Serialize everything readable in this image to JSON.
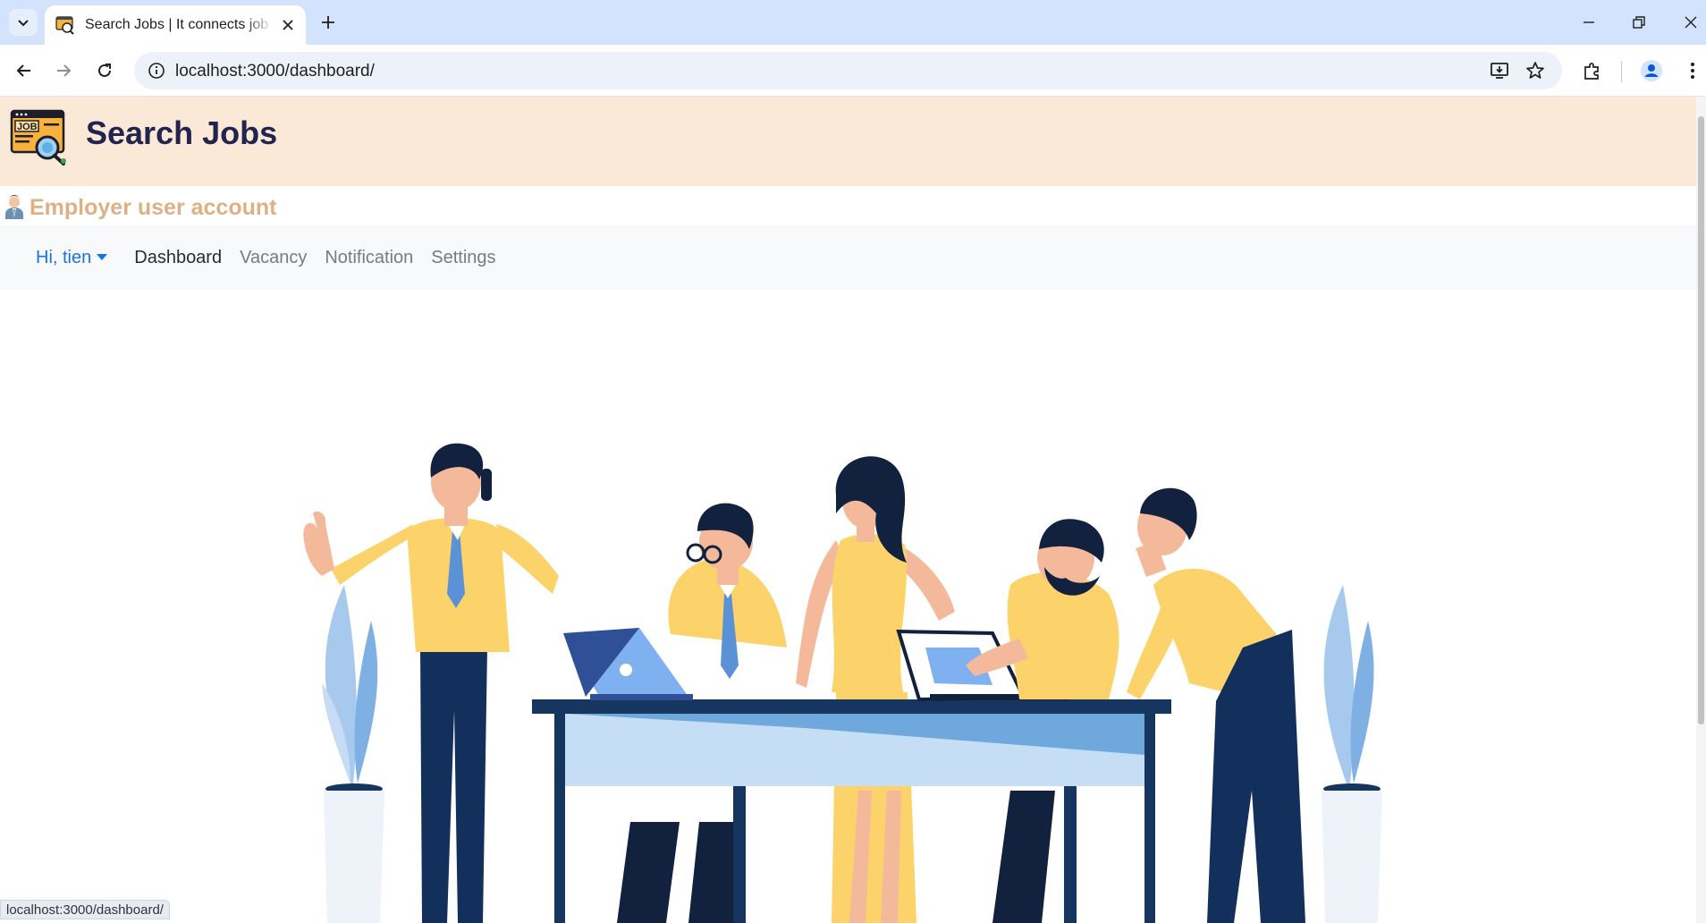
{
  "browser": {
    "tab_title": "Search Jobs | It connects job seekers",
    "new_tab_label": "+",
    "url": "localhost:3000/dashboard/",
    "status_url": "localhost:3000/dashboard/"
  },
  "site": {
    "title": "Search Jobs",
    "logo_text": "JOB",
    "account_label": "Employer user account"
  },
  "nav": {
    "user_menu": "Hi, tien",
    "items": [
      {
        "label": "Dashboard",
        "active": true
      },
      {
        "label": "Vacancy",
        "active": false
      },
      {
        "label": "Notification",
        "active": false
      },
      {
        "label": "Settings",
        "active": false
      }
    ]
  },
  "colors": {
    "header_bg": "#fae9d6",
    "title_color": "#22234f",
    "account_color": "#dcb186",
    "user_menu_color": "#1673e6",
    "navbar_bg": "#f8f9fa"
  }
}
